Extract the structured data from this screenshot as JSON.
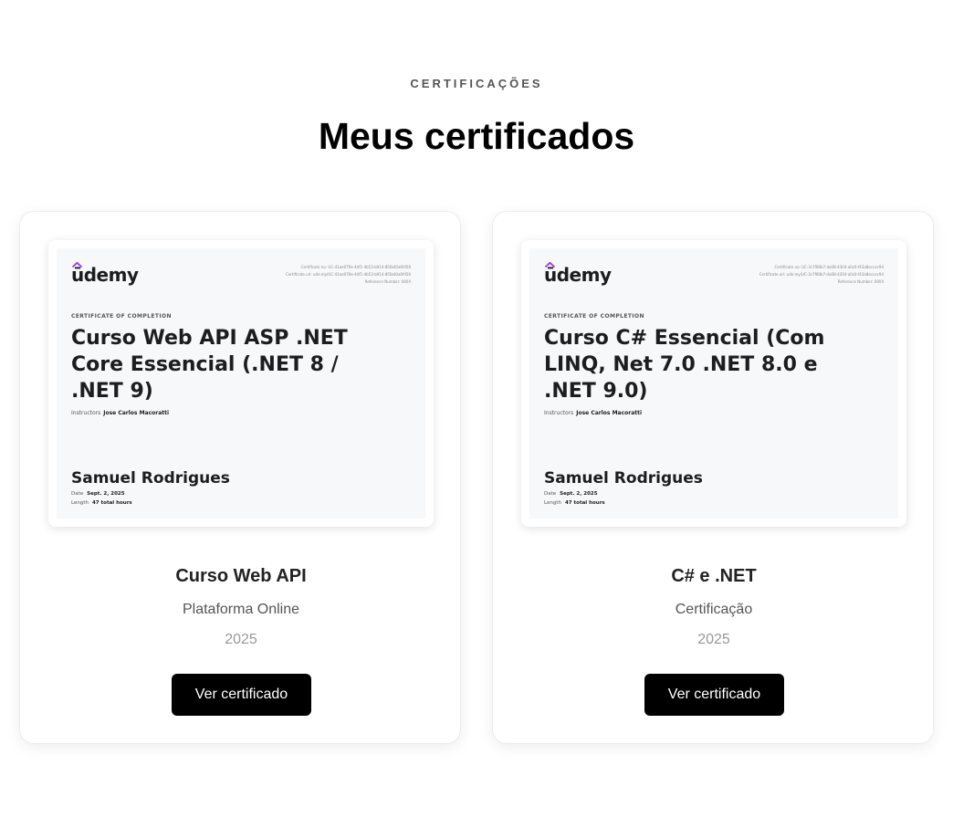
{
  "header": {
    "eyebrow": "CERTIFICAÇÕES",
    "title": "Meus certificados"
  },
  "colors": {
    "button_bg": "#000000",
    "button_text": "#ffffff",
    "udemy_accent": "#a435f0"
  },
  "certificates": [
    {
      "preview": {
        "logo_text": "ūdemy",
        "meta_lines": [
          "Certificate no: UC-41ae079e-44f1-4b53-b914-8f3b40a6fd56",
          "Certificate url: ude.my/UC-41ae079e-44f1-4b53-b914-8f3b40a6fd56",
          "Reference Number: 0004"
        ],
        "kicker": "CERTIFICATE OF COMPLETION",
        "course_title": "Curso Web API ASP .NET Core Essencial (.NET 8 / .NET 9)",
        "instructors_label": "Instructors",
        "instructor": "Jose Carlos Macoratti",
        "student": "Samuel Rodrigues",
        "date_label": "Date",
        "date": "Sept. 2, 2025",
        "length_label": "Length",
        "length": "47 total hours"
      },
      "name": "Curso Web API",
      "issuer": "Plataforma Online",
      "year": "2025",
      "button": "Ver certificado"
    },
    {
      "preview": {
        "logo_text": "ūdemy",
        "meta_lines": [
          "Certificate no: UC-3c7f80b7-da08-4304-a0c0-f43a8eccec94",
          "Certificate url: ude.my/UC-3c7f80b7-da08-4304-a0c0-f43a8eccec94",
          "Reference Number: 0004"
        ],
        "kicker": "CERTIFICATE OF COMPLETION",
        "course_title": "Curso C# Essencial (Com LINQ, Net 7.0 .NET 8.0 e .NET 9.0)",
        "instructors_label": "Instructors",
        "instructor": "Jose Carlos Macoratti",
        "student": "Samuel Rodrigues",
        "date_label": "Date",
        "date": "Sept. 2, 2025",
        "length_label": "Length",
        "length": "47 total hours"
      },
      "name": "C# e .NET",
      "issuer": "Certificação",
      "year": "2025",
      "button": "Ver certificado"
    }
  ]
}
